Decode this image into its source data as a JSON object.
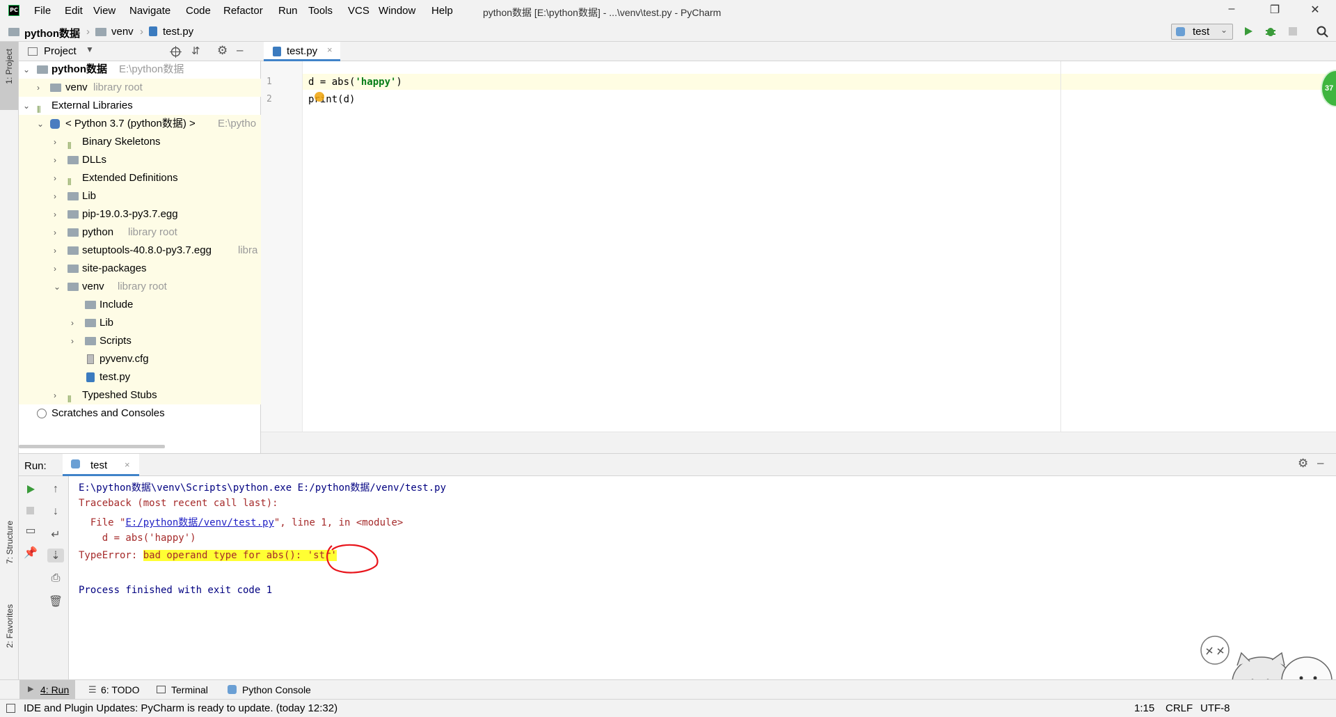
{
  "window": {
    "title": "python数据 [E:\\python数据] - ...\\venv\\test.py - PyCharm",
    "logo": "PC",
    "minimize": "–",
    "restore": "❐",
    "close": "✕"
  },
  "menu": [
    "File",
    "Edit",
    "View",
    "Navigate",
    "Code",
    "Refactor",
    "Run",
    "Tools",
    "VCS",
    "Window",
    "Help"
  ],
  "breadcrumb": [
    "python数据",
    "venv",
    "test.py"
  ],
  "run_config": {
    "label": "test"
  },
  "left_stripe": {
    "project_tab": "1: Project",
    "structure_tab": "7: Structure",
    "favorites_tab": "2: Favorites"
  },
  "project_panel": {
    "title": "Project",
    "tree": [
      {
        "label": "python数据",
        "hint": "E:\\python数据",
        "bold": true
      },
      {
        "label": "venv",
        "hint": "library root"
      },
      {
        "label": "External Libraries",
        "hint": ""
      },
      {
        "label": "< Python 3.7 (python数据) >",
        "hint": "E:\\pytho"
      },
      {
        "label": "Binary Skeletons",
        "hint": ""
      },
      {
        "label": "DLLs",
        "hint": ""
      },
      {
        "label": "Extended Definitions",
        "hint": ""
      },
      {
        "label": "Lib",
        "hint": ""
      },
      {
        "label": "pip-19.0.3-py3.7.egg",
        "hint": ""
      },
      {
        "label": "python",
        "hint": "library root"
      },
      {
        "label": "setuptools-40.8.0-py3.7.egg",
        "hint": "libra"
      },
      {
        "label": "site-packages",
        "hint": ""
      },
      {
        "label": "venv",
        "hint": "library root"
      },
      {
        "label": "Include",
        "hint": ""
      },
      {
        "label": "Lib",
        "hint": ""
      },
      {
        "label": "Scripts",
        "hint": ""
      },
      {
        "label": "pyvenv.cfg",
        "hint": ""
      },
      {
        "label": "test.py",
        "hint": ""
      },
      {
        "label": "Typeshed Stubs",
        "hint": ""
      },
      {
        "label": "Scratches and Consoles",
        "hint": ""
      }
    ]
  },
  "editor": {
    "tab": "test.py",
    "line_numbers": [
      "1",
      "2"
    ],
    "lines": {
      "l1_var": "d = ",
      "l1_func": "abs(",
      "l1_str": "'happy'",
      "l1_end": ")",
      "l2": "print(d)"
    },
    "inspection_count": "37"
  },
  "run_panel": {
    "label": "Run:",
    "tab": "test",
    "console": {
      "cmd": "E:\\python数据\\venv\\Scripts\\python.exe E:/python数据/venv/test.py",
      "traceback": "Traceback (most recent call last):",
      "file_prefix": "  File \"",
      "file_link": "E:/python数据/venv/test.py",
      "file_suffix": "\", line 1, in <module>",
      "code": "    d = abs('happy')",
      "error_prefix": "TypeError: ",
      "error_msg": "bad operand type for abs(): ",
      "error_type": "'str'",
      "finish": "Process finished with exit code 1"
    }
  },
  "bottom_tabs": {
    "run": "4: Run",
    "todo": "6: TODO",
    "terminal": "Terminal",
    "python_console": "Python Console"
  },
  "status": {
    "message": "IDE and Plugin Updates: PyCharm is ready to update. (today 12:32)",
    "position": "1:15",
    "line_sep": "CRLF",
    "encoding": "UTF-8"
  },
  "colors": {
    "accent": "#4083c9",
    "highlight": "#ffff33",
    "error_text": "#a52a2a",
    "console_blue": "#000080",
    "annotation_red": "#e8141b"
  }
}
